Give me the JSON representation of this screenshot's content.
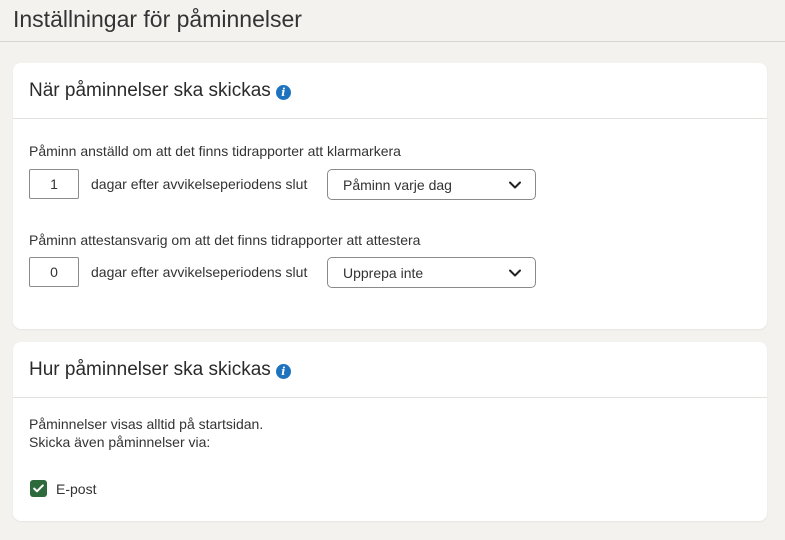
{
  "page": {
    "title": "Inställningar för påminnelser"
  },
  "when_section": {
    "title": "När påminnelser ska skickas",
    "employee": {
      "label": "Påminn anställd om att det finns tidrapporter att klarmarkera",
      "days_value": "1",
      "unit_text": "dagar efter avvikelseperiodens slut",
      "repeat_selected": "Påminn varje dag"
    },
    "approver": {
      "label": "Påminn attestansvarig om att det finns tidrapporter att attestera",
      "days_value": "0",
      "unit_text": "dagar efter avvikelseperiodens slut",
      "repeat_selected": "Upprepa inte"
    }
  },
  "how_section": {
    "title": "Hur påminnelser ska skickas",
    "line1": "Påminnelser visas alltid på startsidan.",
    "line2": "Skicka även påminnelser via:",
    "email_label": "E-post",
    "email_checked": true
  },
  "colors": {
    "info_icon": "#1e73be",
    "checkbox": "#2e6b3c",
    "background": "#f4f2ef"
  },
  "icons": [
    "info-icon",
    "chevron-down-icon",
    "checkmark-icon"
  ]
}
